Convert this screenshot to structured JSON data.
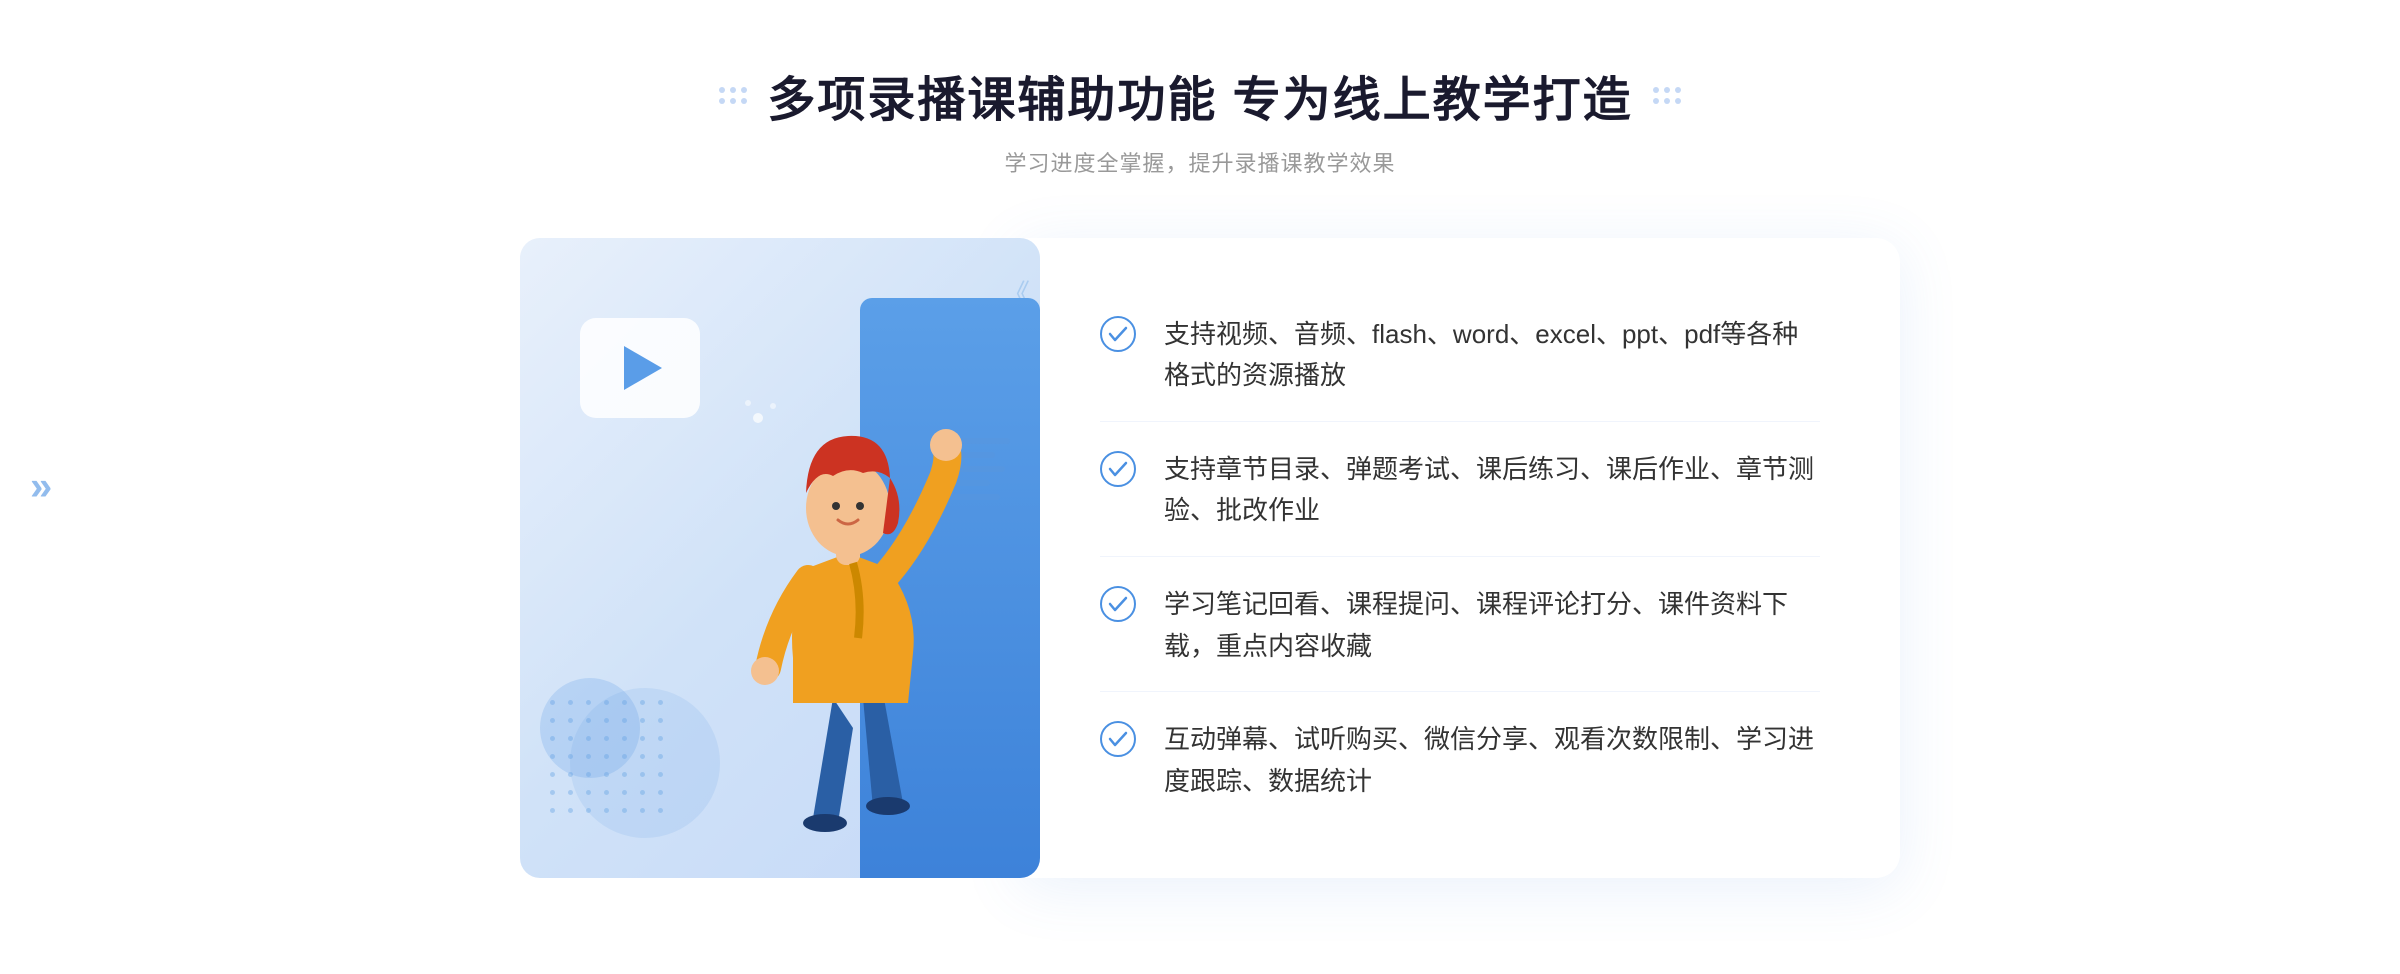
{
  "header": {
    "main_title": "多项录播课辅助功能 专为线上教学打造",
    "sub_title": "学习进度全掌握，提升录播课教学效果"
  },
  "features": [
    {
      "id": 1,
      "text": "支持视频、音频、flash、word、excel、ppt、pdf等各种格式的资源播放"
    },
    {
      "id": 2,
      "text": "支持章节目录、弹题考试、课后练习、课后作业、章节测验、批改作业"
    },
    {
      "id": 3,
      "text": "学习笔记回看、课程提问、课程评论打分、课件资料下载，重点内容收藏"
    },
    {
      "id": 4,
      "text": "互动弹幕、试听购买、微信分享、观看次数限制、学习进度跟踪、数据统计"
    }
  ],
  "decorative": {
    "left_chevron": "»",
    "play_icon": "▶",
    "check_color": "#4a90e2",
    "accent_blue": "#4a90e2"
  }
}
